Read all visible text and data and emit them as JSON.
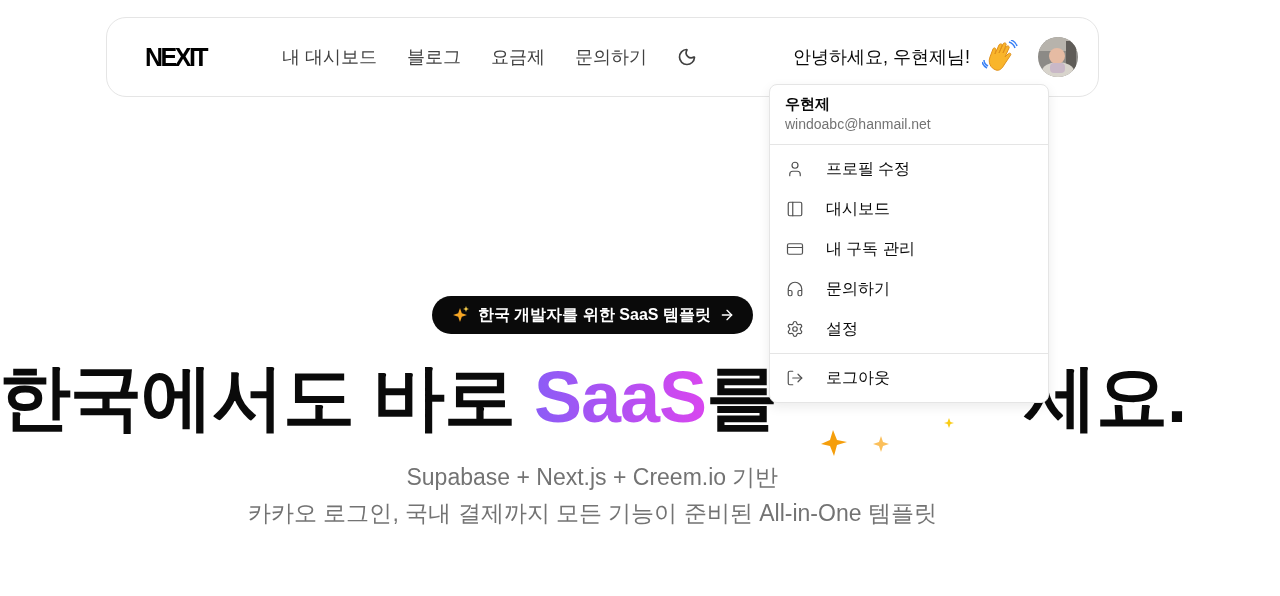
{
  "nav": {
    "logo": "NEXIT",
    "links": [
      {
        "label": "내 대시보드"
      },
      {
        "label": "블로그"
      },
      {
        "label": "요금제"
      },
      {
        "label": "문의하기"
      }
    ],
    "greeting": "안녕하세요, 우현제님!"
  },
  "user_menu": {
    "name": "우현제",
    "email": "windoabc@hanmail.net",
    "groups": [
      [
        {
          "label": "프로필 수정"
        },
        {
          "label": "대시보드"
        },
        {
          "label": "내 구독 관리"
        },
        {
          "label": "문의하기"
        },
        {
          "label": "설정"
        }
      ],
      [
        {
          "label": "로그아웃"
        }
      ]
    ]
  },
  "hero": {
    "badge": "한국 개발자를 위한 SaaS 템플릿",
    "headline": {
      "before": "한국에서도 바로 ",
      "highlight": "SaaS",
      "after": "를",
      "tail": "세요."
    },
    "subtitle": [
      "Supabase + Next.js + Creem.io 기반",
      "카카오 로그인, 국내 결제까지 모든 기능이 준비된 All-in-One 템플릿"
    ]
  }
}
